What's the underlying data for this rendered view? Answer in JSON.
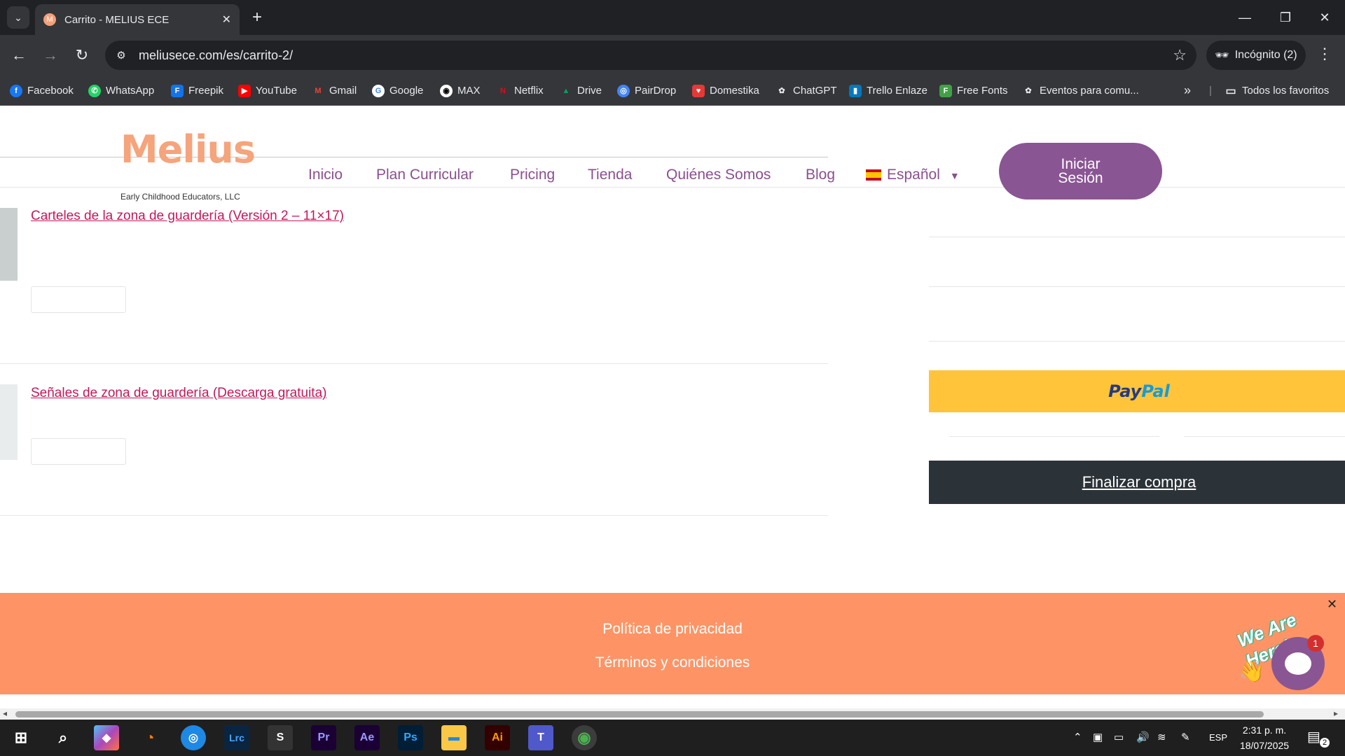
{
  "browser": {
    "tab_title": "Carrito - MELIUS ECE",
    "url": "meliusece.com/es/carrito-2/",
    "incognito_label": "Incógnito (2)",
    "bookmarks": [
      "Facebook",
      "WhatsApp",
      "Freepik",
      "YouTube",
      "Gmail",
      "Google",
      "MAX",
      "Netflix",
      "Drive",
      "PairDrop",
      "Domestika",
      "ChatGPT",
      "Trello Enlaze",
      "Free Fonts",
      "Eventos para comu..."
    ],
    "all_bookmarks_label": "Todos los favoritos",
    "more_label": "»"
  },
  "site": {
    "logo_text": "Melius",
    "logo_sub": "Early Childhood Educators, LLC",
    "nav": [
      "Inicio",
      "Plan Curricular",
      "Pricing",
      "Tienda",
      "Quiénes Somos",
      "Blog"
    ],
    "language": "Español",
    "login_line1": "Iniciar",
    "login_line2": "Sesión"
  },
  "cart": {
    "items": [
      {
        "name": "Carteles de la zona de guardería (Versión 2 – 11×17)"
      },
      {
        "name": "Señales de zona de guardería (Descarga gratuita)"
      }
    ],
    "paypal_pay": "Pay",
    "paypal_pal": "Pal",
    "checkout_label": "Finalizar compra"
  },
  "footer": {
    "privacy": "Política de privacidad",
    "terms": "Términos y condiciones"
  },
  "chat": {
    "banner": "We Are Here!",
    "badge_count": "1"
  },
  "taskbar": {
    "lang": "ESP",
    "time": "2:31 p. m.",
    "date": "18/07/2025",
    "notif_count": "2"
  },
  "colors": {
    "accent_purple": "#8a5593",
    "footer_orange": "#fe9465",
    "link_pink": "#c2185b",
    "paypal_yellow": "#ffc439",
    "checkout_dark": "#2c3338"
  }
}
